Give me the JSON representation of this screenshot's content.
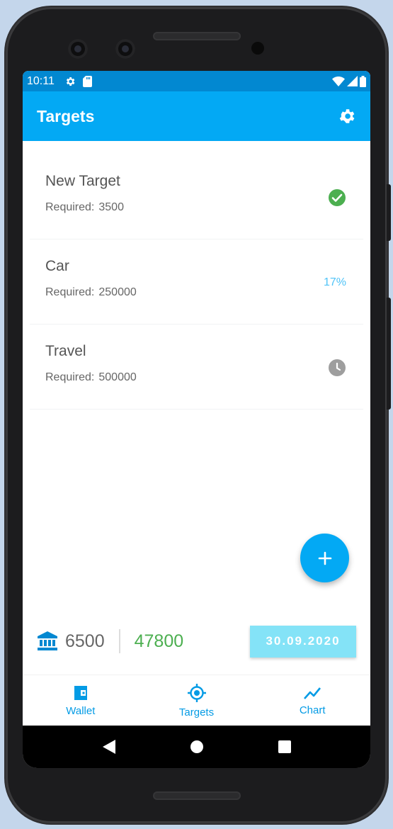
{
  "status_bar": {
    "time": "10:11"
  },
  "app_bar": {
    "title": "Targets"
  },
  "targets": [
    {
      "name": "New Target",
      "required_label": "Required:",
      "required_value": "3500",
      "status": "check-circle-icon"
    },
    {
      "name": "Car",
      "required_label": "Required:",
      "required_value": "250000",
      "status": "percent",
      "percent": "17%"
    },
    {
      "name": "Travel",
      "required_label": "Required:",
      "required_value": "500000",
      "status": "clock-icon"
    }
  ],
  "summary": {
    "balance": "6500",
    "saved": "47800",
    "date": "30.09.2020"
  },
  "bottom_nav": {
    "items": [
      {
        "label": "Wallet",
        "icon": "wallet-icon"
      },
      {
        "label": "Targets",
        "icon": "target-icon"
      },
      {
        "label": "Chart",
        "icon": "chart-icon"
      }
    ]
  },
  "colors": {
    "primary": "#03a9f4",
    "primary_dark": "#0288d1",
    "success": "#4caf50",
    "percent": "#4fc3f7",
    "date_chip": "#84e3f7"
  }
}
